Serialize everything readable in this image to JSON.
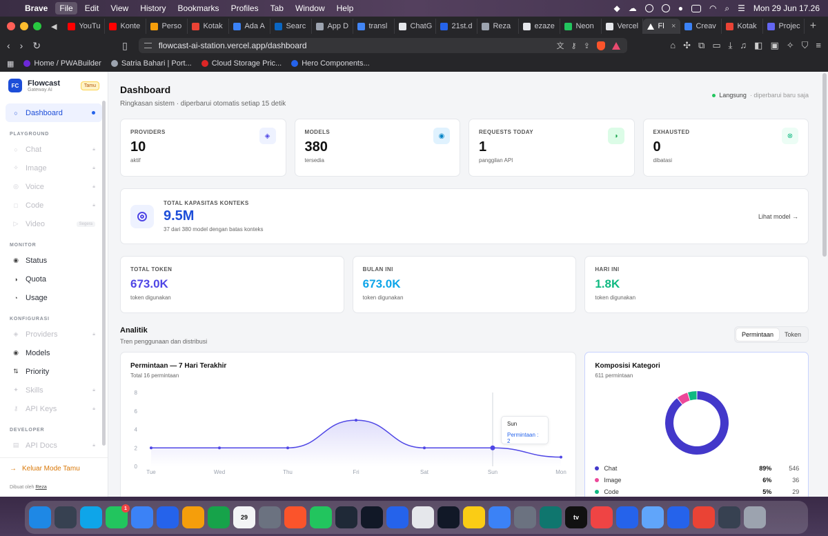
{
  "menubar": {
    "app": "Brave",
    "items": [
      "File",
      "Edit",
      "View",
      "History",
      "Bookmarks",
      "Profiles",
      "Tab",
      "Window",
      "Help"
    ],
    "clock": "Mon 29 Jun  17.26"
  },
  "browser": {
    "tabs": [
      {
        "label": "YouTu",
        "color": "#ff0000"
      },
      {
        "label": "Konte",
        "color": "#ff0000"
      },
      {
        "label": "Perso",
        "color": "#f59e0b"
      },
      {
        "label": "Kotak",
        "color": "#ea4335"
      },
      {
        "label": "Ada A",
        "color": "#3b82f6"
      },
      {
        "label": "Searc",
        "color": "#0a66c2"
      },
      {
        "label": "App D",
        "color": "#9ca3af"
      },
      {
        "label": "transl",
        "color": "#4285f4"
      },
      {
        "label": "ChatG",
        "color": "#e5e7eb"
      },
      {
        "label": "21st.d",
        "color": "#2563eb"
      },
      {
        "label": "Reza",
        "color": "#9ca3af"
      },
      {
        "label": "ezaze",
        "color": "#e5e7eb"
      },
      {
        "label": "Neon",
        "color": "#22c55e"
      },
      {
        "label": "Vercel",
        "color": "#e5e7eb"
      }
    ],
    "active_tab": {
      "label": "Fl",
      "close": "×"
    },
    "tabs_after": [
      {
        "label": "Creav",
        "color": "#3b82f6"
      },
      {
        "label": "Kotak",
        "color": "#ea4335"
      },
      {
        "label": "Projec",
        "color": "#6366f1"
      }
    ],
    "new_tab": "+",
    "url": "flowcast-ai-station.vercel.app/dashboard",
    "bookmarks": [
      {
        "label": "Home / PWABuilder",
        "color": "#6d28d9"
      },
      {
        "label": "Satria Bahari | Port...",
        "color": "#9ca3af"
      },
      {
        "label": "Cloud Storage Pric...",
        "color": "#dc2626"
      },
      {
        "label": "Hero Components...",
        "color": "#2563eb"
      }
    ]
  },
  "sidebar": {
    "logo": "FC",
    "brand": "Flowcast",
    "brand_sub": "Gateway AI",
    "badge": "Tamu",
    "dashboard": "Dashboard",
    "sections": {
      "playground": "PLAYGROUND",
      "monitor": "MONITOR",
      "config": "KONFIGURASI",
      "developer": "DEVELOPER"
    },
    "playground": [
      "Chat",
      "Image",
      "Voice",
      "Code",
      "Video"
    ],
    "video_badge": "Segera",
    "monitor": [
      "Status",
      "Quota",
      "Usage"
    ],
    "config": [
      "Providers",
      "Models",
      "Priority",
      "Skills",
      "API Keys"
    ],
    "developer": [
      "API Docs"
    ],
    "exit": "Keluar Mode Tamu",
    "made_by": "Dibuat oleh",
    "author": "Reza"
  },
  "header": {
    "title": "Dashboard",
    "subtitle": "Ringkasan sistem · diperbarui otomatis setiap 15 detik",
    "live": "Langsung",
    "updated": "· diperbarui baru saja"
  },
  "stats": [
    {
      "label": "PROVIDERS",
      "value": "10",
      "sub": "aktif",
      "icon": "◈",
      "bg": "#eef2ff",
      "fg": "#4f46e5"
    },
    {
      "label": "MODELS",
      "value": "380",
      "sub": "tersedia",
      "icon": "◉",
      "bg": "#e0f2fe",
      "fg": "#0284c7"
    },
    {
      "label": "REQUESTS TODAY",
      "value": "1",
      "sub": "panggilan API",
      "icon": "◑",
      "bg": "#dcfce7",
      "fg": "#16a34a"
    },
    {
      "label": "EXHAUSTED",
      "value": "0",
      "sub": "dibatasi",
      "icon": "⊗",
      "bg": "#ecfdf5",
      "fg": "#10b981"
    }
  ],
  "capacity": {
    "label": "TOTAL KAPASITAS KONTEKS",
    "value": "9.5M",
    "sub": "37 dari 380 model dengan batas konteks",
    "link": "Lihat model →"
  },
  "tokens": [
    {
      "label": "TOTAL TOKEN",
      "value": "673.0K",
      "sub": "token digunakan",
      "color": "#4f46e5"
    },
    {
      "label": "BULAN INI",
      "value": "673.0K",
      "sub": "token digunakan",
      "color": "#0ea5e9"
    },
    {
      "label": "HARI INI",
      "value": "1.8K",
      "sub": "token digunakan",
      "color": "#10b981"
    }
  ],
  "analytics": {
    "title": "Analitik",
    "subtitle": "Tren penggunaan dan distribusi",
    "toggle": [
      "Permintaan",
      "Token"
    ]
  },
  "line_chart": {
    "title": "Permintaan — 7 Hari Terakhir",
    "subtitle": "Total 16 permintaan",
    "tooltip_day": "Sun",
    "tooltip_value": "Permintaan : 2"
  },
  "donut": {
    "title": "Komposisi Kategori",
    "subtitle": "611 permintaan",
    "legend": [
      {
        "name": "Chat",
        "pct": "89%",
        "count": "546",
        "color": "#4338ca"
      },
      {
        "name": "Image",
        "pct": "6%",
        "count": "36",
        "color": "#ec4899"
      },
      {
        "name": "Code",
        "pct": "5%",
        "count": "29",
        "color": "#10b981"
      }
    ]
  },
  "chart_data": [
    {
      "type": "area",
      "title": "Permintaan — 7 Hari Terakhir",
      "categories": [
        "Tue",
        "Wed",
        "Thu",
        "Fri",
        "Sat",
        "Sun",
        "Mon"
      ],
      "series": [
        {
          "name": "Permintaan",
          "values": [
            2,
            2,
            2,
            5,
            2,
            2,
            1
          ]
        }
      ],
      "yticks": [
        0,
        2,
        4,
        6,
        8
      ],
      "ylim": [
        0,
        8
      ],
      "color": "#4f46e5",
      "grid": false
    },
    {
      "type": "pie",
      "title": "Komposisi Kategori",
      "categories": [
        "Chat",
        "Image",
        "Code"
      ],
      "values": [
        546,
        36,
        29
      ],
      "colors": [
        "#4338ca",
        "#ec4899",
        "#10b981"
      ],
      "donut": true
    }
  ],
  "dock": [
    {
      "name": "finder",
      "color": "#1e88e5"
    },
    {
      "name": "launchpad",
      "color": "#374151"
    },
    {
      "name": "safari",
      "color": "#0ea5e9"
    },
    {
      "name": "messages",
      "color": "#22c55e",
      "badge": "1"
    },
    {
      "name": "mail",
      "color": "#3b82f6"
    },
    {
      "name": "app-store",
      "color": "#2563eb"
    },
    {
      "name": "photos",
      "color": "#f59e0b"
    },
    {
      "name": "facetime",
      "color": "#16a34a"
    },
    {
      "name": "calendar",
      "color": "#f3f4f6",
      "text": "29"
    },
    {
      "name": "contacts",
      "color": "#6b7280"
    },
    {
      "name": "brave",
      "color": "#fb542b"
    },
    {
      "name": "whatsapp",
      "color": "#22c55e"
    },
    {
      "name": "reminders",
      "color": "#1f2937"
    },
    {
      "name": "cursor",
      "color": "#111827"
    },
    {
      "name": "vscode",
      "color": "#2563eb"
    },
    {
      "name": "arc",
      "color": "#e5e7eb"
    },
    {
      "name": "terminal",
      "color": "#111827"
    },
    {
      "name": "notes",
      "color": "#facc15"
    },
    {
      "name": "simplenote",
      "color": "#3b82f6"
    },
    {
      "name": "settings",
      "color": "#6b7280"
    },
    {
      "name": "activity",
      "color": "#0f766e"
    },
    {
      "name": "tv",
      "color": "#111111",
      "text": "tv"
    },
    {
      "name": "music",
      "color": "#ef4444"
    },
    {
      "name": "xcode",
      "color": "#2563eb"
    },
    {
      "name": "preview",
      "color": "#60a5fa"
    },
    {
      "name": "word",
      "color": "#2563eb"
    },
    {
      "name": "chrome",
      "color": "#ea4335"
    },
    {
      "name": "downloads",
      "color": "#374151"
    },
    {
      "name": "trash",
      "color": "#9ca3af"
    }
  ]
}
